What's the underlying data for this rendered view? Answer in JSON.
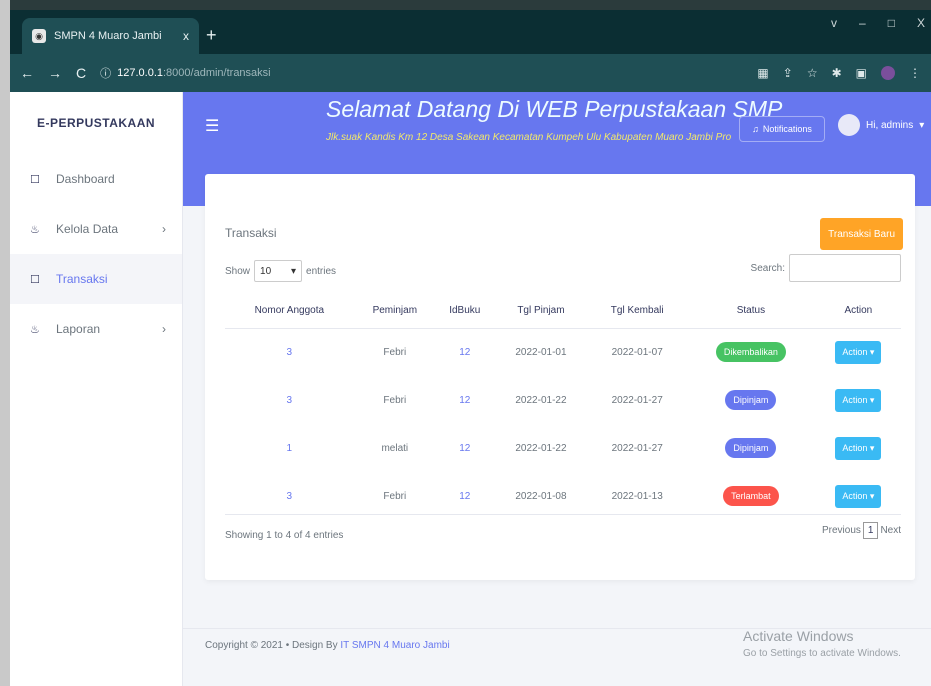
{
  "browser": {
    "tab_title": "SMPN 4 Muaro Jambi",
    "tab_close": "x",
    "new_tab": "+",
    "url_host": "127.0.0.1",
    "url_path": ":8000/admin/transaksi",
    "window_controls": [
      "v",
      "–",
      "□",
      "X"
    ]
  },
  "sidebar": {
    "brand": "E-PERPUSTAKAAN",
    "items": [
      {
        "label": "Dashboard",
        "icon": "square-icon"
      },
      {
        "label": "Kelola Data",
        "icon": "fire-icon",
        "chevron": "›"
      },
      {
        "label": "Transaksi",
        "icon": "square-icon"
      },
      {
        "label": "Laporan",
        "icon": "fire-icon",
        "chevron": "›"
      }
    ]
  },
  "header": {
    "welcome": "Selamat Datang Di WEB Perpustakaan SMP",
    "address": "Jlk.suak Kandis Km 12 Desa Sakean Kecamatan Kumpeh Ulu Kabupaten Muaro Jambi Pro",
    "notifications_label": "Notifications",
    "user_label": "Hi, admins"
  },
  "card": {
    "title": "Transaksi",
    "new_button": "Transaksi Baru",
    "show_label": "Show",
    "entries_value": "10",
    "entries_label": "entries",
    "search_label": "Search:",
    "columns": [
      "Nomor Anggota",
      "Peminjam",
      "IdBuku",
      "Tgl Pinjam",
      "Tgl Kembali",
      "Status",
      "Action"
    ],
    "rows": [
      {
        "anggota": "3",
        "peminjam": "Febri",
        "idbuku": "12",
        "pinjam": "2022-01-01",
        "kembali": "2022-01-07",
        "status": "Dikembalikan",
        "status_color": "#47c363",
        "action": "Action"
      },
      {
        "anggota": "3",
        "peminjam": "Febri",
        "idbuku": "12",
        "pinjam": "2022-01-22",
        "kembali": "2022-01-27",
        "status": "Dipinjam",
        "status_color": "#6777ef",
        "action": "Action"
      },
      {
        "anggota": "1",
        "peminjam": "melati",
        "idbuku": "12",
        "pinjam": "2022-01-22",
        "kembali": "2022-01-27",
        "status": "Dipinjam",
        "status_color": "#6777ef",
        "action": "Action"
      },
      {
        "anggota": "3",
        "peminjam": "Febri",
        "idbuku": "12",
        "pinjam": "2022-01-08",
        "kembali": "2022-01-13",
        "status": "Terlambat",
        "status_color": "#fc544b",
        "action": "Action"
      }
    ],
    "info": "Showing 1 to 4 of 4 entries",
    "previous": "Previous",
    "page": "1",
    "next": "Next"
  },
  "footer": {
    "copyright": "Copyright © 2021 • Design By",
    "link": "IT SMPN 4 Muaro Jambi"
  },
  "watermark": {
    "line1": "Activate Windows",
    "line2": "Go to Settings to activate Windows."
  }
}
